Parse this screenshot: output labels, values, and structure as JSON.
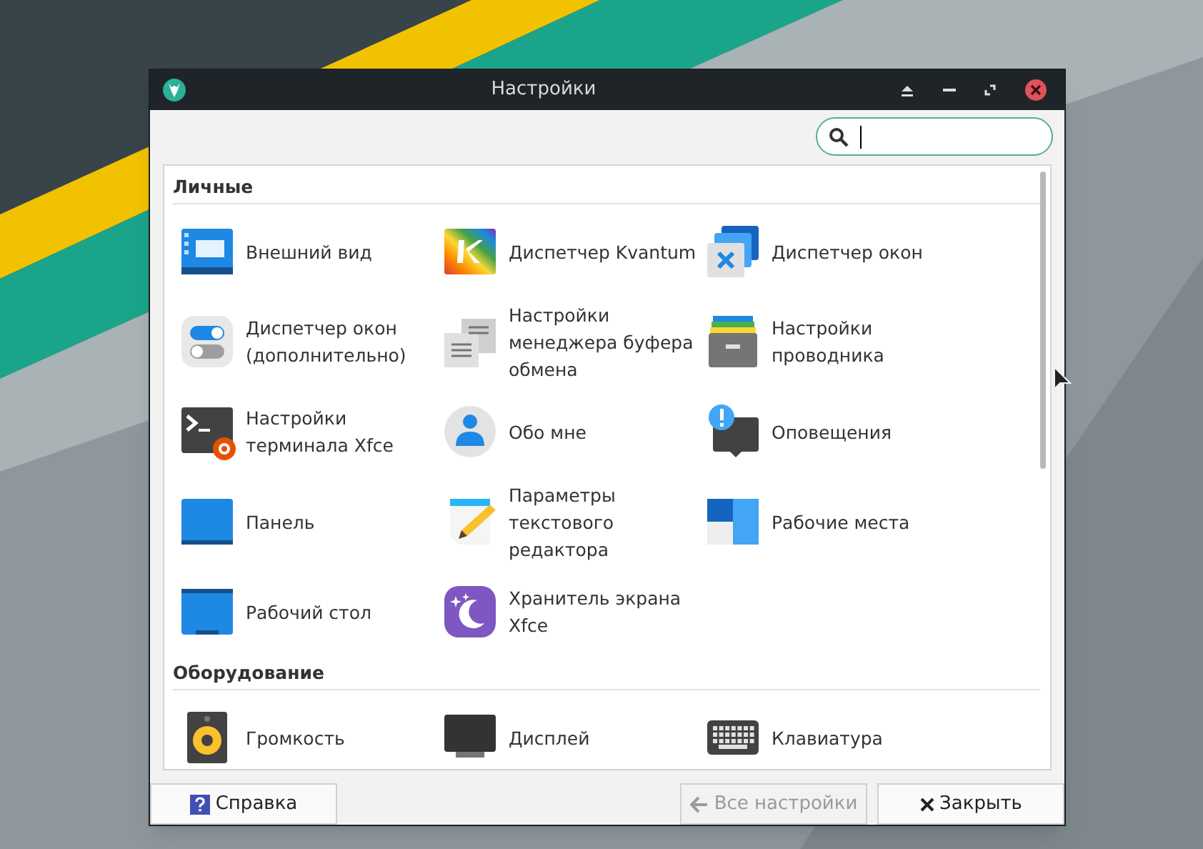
{
  "window": {
    "title": "Настройки"
  },
  "sections": [
    {
      "title": "Личные",
      "items": [
        {
          "lines": [
            "Внешний вид"
          ]
        },
        {
          "lines": [
            "Диспетчер Kvantum"
          ]
        },
        {
          "lines": [
            "Диспетчер окон"
          ]
        },
        {
          "lines": [
            "Диспетчер окон",
            "(дополнительно)"
          ]
        },
        {
          "lines": [
            "Настройки",
            "менеджера буфера",
            "обмена"
          ]
        },
        {
          "lines": [
            "Настройки",
            "проводника"
          ]
        },
        {
          "lines": [
            "Настройки",
            "терминала Xfce"
          ]
        },
        {
          "lines": [
            "Обо мне"
          ]
        },
        {
          "lines": [
            "Оповещения"
          ]
        },
        {
          "lines": [
            "Панель"
          ]
        },
        {
          "lines": [
            "Параметры",
            "текстового",
            "редактора"
          ]
        },
        {
          "lines": [
            "Рабочие места"
          ]
        },
        {
          "lines": [
            "Рабочий стол"
          ]
        },
        {
          "lines": [
            "Хранитель экрана",
            "Xfce"
          ]
        }
      ]
    },
    {
      "title": "Оборудование",
      "items": [
        {
          "lines": [
            "Громкость"
          ]
        },
        {
          "lines": [
            "Дисплей"
          ]
        },
        {
          "lines": [
            "Клавиатура"
          ]
        }
      ]
    }
  ],
  "buttons": [
    {
      "label": "Справка",
      "disabled": false
    },
    {
      "label": "Все настройки",
      "disabled": true
    },
    {
      "label": "Закрыть",
      "disabled": false
    }
  ]
}
